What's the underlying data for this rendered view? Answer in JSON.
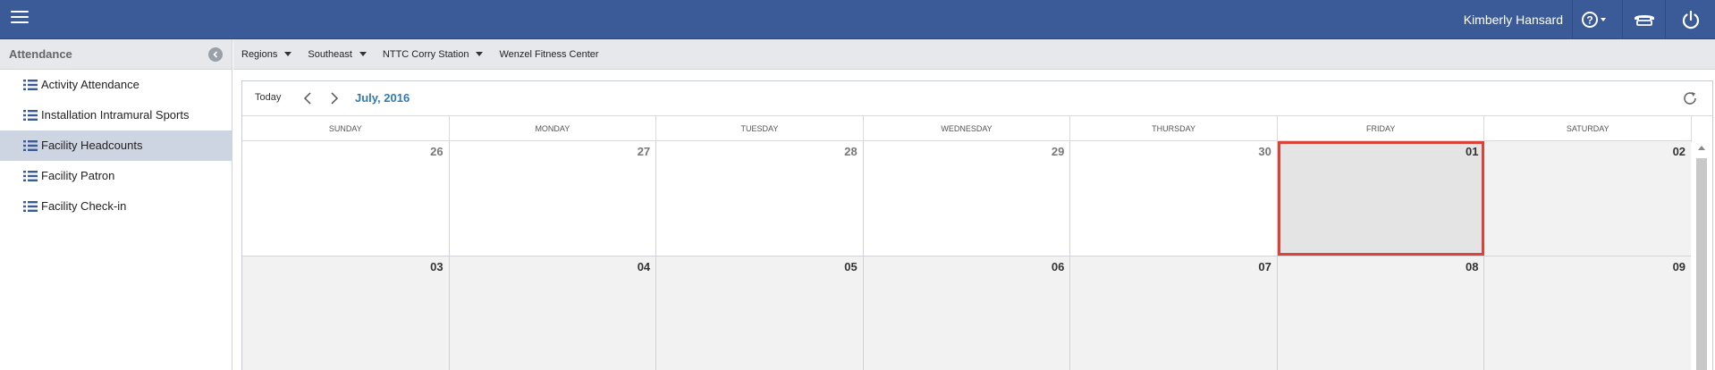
{
  "header": {
    "user_name": "Kimberly Hansard",
    "help_label": "?"
  },
  "sidebar": {
    "title": "Attendance",
    "items": [
      {
        "label": "Activity Attendance",
        "active": false
      },
      {
        "label": "Installation Intramural Sports",
        "active": false
      },
      {
        "label": "Facility Headcounts",
        "active": true
      },
      {
        "label": "Facility Patron",
        "active": false
      },
      {
        "label": "Facility Check-in",
        "active": false
      }
    ]
  },
  "breadcrumb": {
    "items": [
      {
        "label": "Regions",
        "dropdown": true
      },
      {
        "label": "Southeast",
        "dropdown": true
      },
      {
        "label": "NTTC Corry Station",
        "dropdown": true
      },
      {
        "label": "Wenzel Fitness Center",
        "dropdown": false
      }
    ]
  },
  "calendar": {
    "today_label": "Today",
    "month_title": "July, 2016",
    "day_headers": [
      "SUNDAY",
      "MONDAY",
      "TUESDAY",
      "WEDNESDAY",
      "THURSDAY",
      "FRIDAY",
      "SATURDAY"
    ],
    "weeks": [
      [
        {
          "day": "26",
          "state": "other-month"
        },
        {
          "day": "27",
          "state": "other-month"
        },
        {
          "day": "28",
          "state": "other-month"
        },
        {
          "day": "29",
          "state": "other-month"
        },
        {
          "day": "30",
          "state": "other-month"
        },
        {
          "day": "01",
          "state": "selected"
        },
        {
          "day": "02",
          "state": "current-month"
        }
      ],
      [
        {
          "day": "03",
          "state": "current-month"
        },
        {
          "day": "04",
          "state": "current-month"
        },
        {
          "day": "05",
          "state": "current-month"
        },
        {
          "day": "06",
          "state": "current-month"
        },
        {
          "day": "07",
          "state": "current-month"
        },
        {
          "day": "08",
          "state": "current-month"
        },
        {
          "day": "09",
          "state": "current-month"
        }
      ]
    ]
  },
  "colors": {
    "header_bg": "#3a5b98",
    "accent": "#2e7ab8",
    "selected_outline": "#d9433a",
    "active_sidebar": "#cdd4e2"
  }
}
